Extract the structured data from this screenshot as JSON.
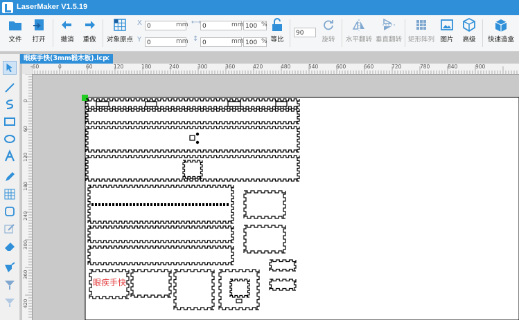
{
  "app": {
    "title": "LaserMaker V1.5.19"
  },
  "toolbar": {
    "file": "文件",
    "open": "打开",
    "undo": "撤消",
    "redo": "重做",
    "origin": "对象原点",
    "x_value": "0",
    "y_value": "0",
    "w_value": "0",
    "h_value": "0",
    "unit": "mm",
    "scale_w": "100",
    "scale_h": "100",
    "percent": "%",
    "lock_ratio": "等比",
    "angle": "90",
    "rotate": "旋转",
    "flip_h": "水平翻转",
    "flip_v": "垂直翻转",
    "array": "矩形阵列",
    "picture": "图片",
    "advanced": "高级",
    "quick_box": "快速造盒"
  },
  "document": {
    "tab_title": "眼疾手快(3mm椴木板).lcp",
    "close": "✕"
  },
  "ruler": {
    "h_labels": [
      "-60",
      "0",
      "60",
      "120",
      "180",
      "240",
      "300",
      "360",
      "420",
      "480",
      "540",
      "600",
      "660",
      "720",
      "780",
      "840",
      "900"
    ],
    "v_labels": [
      "0",
      "60",
      "120",
      "180",
      "240",
      "300",
      "360",
      "420"
    ]
  },
  "canvas": {
    "piece_text": "眼疾手快"
  },
  "colors": {
    "accent": "#2f8fd8",
    "piece_text": "#e23c3c",
    "origin_marker": "#22cc22"
  },
  "tools": [
    "select-icon",
    "line-icon",
    "curve-icon",
    "rectangle-icon",
    "ellipse-icon",
    "text-icon",
    "pen-icon",
    "grid-icon",
    "rounded-rect-icon",
    "edit-icon",
    "eraser-icon",
    "marker-icon",
    "shape-down-icon",
    "shape-down-alt-icon"
  ]
}
